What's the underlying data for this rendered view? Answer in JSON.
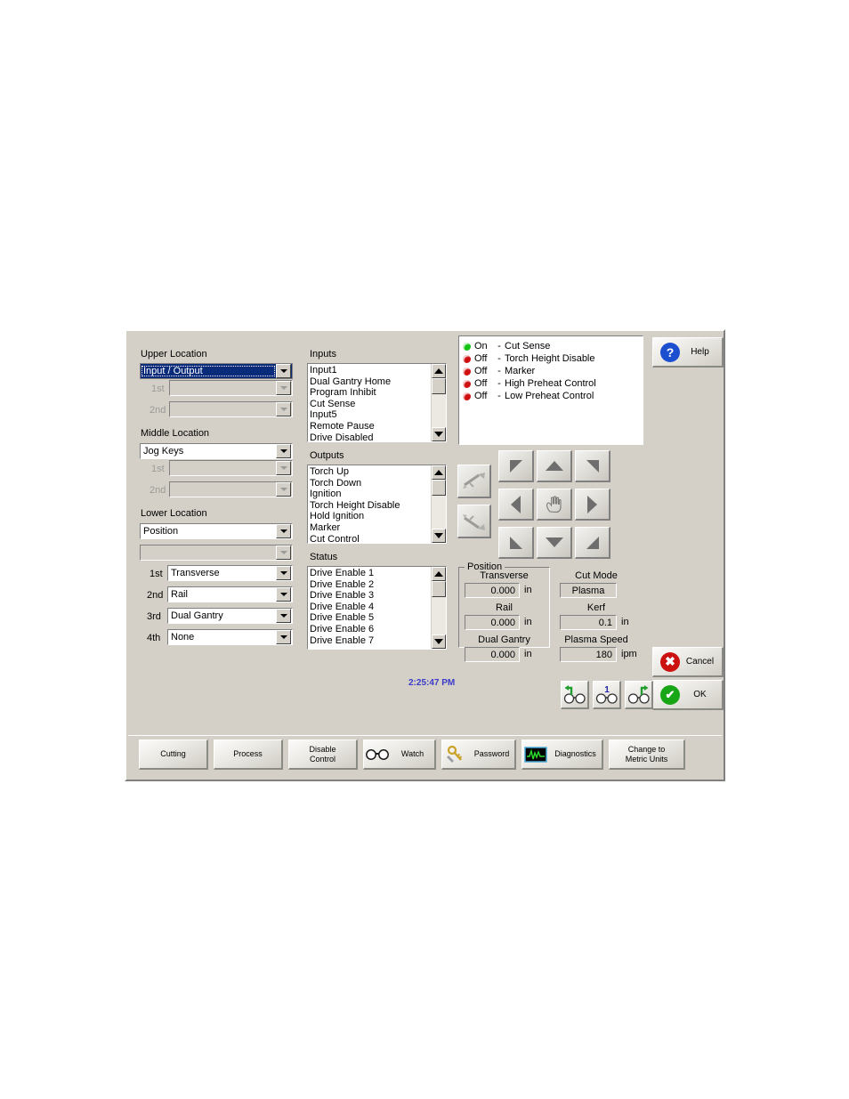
{
  "panel": {
    "clock": "2:25:47 PM"
  },
  "location": {
    "upper": {
      "label": "Upper Location",
      "value": "Input / Output",
      "sub1_label": "1st",
      "sub1_value": "",
      "sub2_label": "2nd",
      "sub2_value": ""
    },
    "middle": {
      "label": "Middle Location",
      "value": "Jog Keys",
      "sub1_label": "1st",
      "sub1_value": "",
      "sub2_label": "2nd",
      "sub2_value": ""
    },
    "lower": {
      "label": "Lower Location",
      "value": "Position",
      "sub_value": ""
    },
    "axes": [
      {
        "label": "1st",
        "value": "Transverse"
      },
      {
        "label": "2nd",
        "value": "Rail"
      },
      {
        "label": "3rd",
        "value": "Dual Gantry"
      },
      {
        "label": "4th",
        "value": "None"
      }
    ]
  },
  "lists": {
    "inputs": {
      "label": "Inputs",
      "items": [
        "Input1",
        "Dual Gantry Home",
        "Program Inhibit",
        "Cut Sense",
        "Input5",
        "Remote Pause",
        "Drive Disabled"
      ]
    },
    "outputs": {
      "label": "Outputs",
      "items": [
        "Torch Up",
        "Torch Down",
        "Ignition",
        "Torch Height Disable",
        "Hold Ignition",
        "Marker",
        "Cut Control"
      ]
    },
    "status": {
      "label": "Status",
      "items": [
        "Drive Enable 1",
        "Drive Enable 2",
        "Drive Enable 3",
        "Drive Enable 4",
        "Drive Enable 5",
        "Drive Enable 6",
        "Drive Enable 7"
      ]
    }
  },
  "indicators": {
    "on_color": "#14c414",
    "off_color": "#d01010",
    "rows": [
      {
        "state": "On",
        "dash": "-",
        "name": "Cut Sense"
      },
      {
        "state": "Off",
        "dash": "-",
        "name": "Torch Height Disable"
      },
      {
        "state": "Off",
        "dash": "-",
        "name": "Marker"
      },
      {
        "state": "Off",
        "dash": "-",
        "name": "High Preheat Control"
      },
      {
        "state": "Off",
        "dash": "-",
        "name": "Low Preheat Control"
      }
    ]
  },
  "jogpad": {
    "up_left": "jog-up-left",
    "up": "jog-up",
    "up_right": "jog-up-right",
    "left": "jog-left",
    "center": "jog-center-hand",
    "right": "jog-right",
    "down_left": "jog-down-left",
    "down": "jog-down",
    "down_right": "jog-down-right",
    "tool_top": "torch-tool-1",
    "tool_bottom": "torch-tool-2"
  },
  "position": {
    "group_label": "Position",
    "rows": [
      {
        "label": "Transverse",
        "value": "0.000",
        "unit": "in"
      },
      {
        "label": "Rail",
        "value": "0.000",
        "unit": "in"
      },
      {
        "label": "Dual Gantry",
        "value": "0.000",
        "unit": "in"
      }
    ]
  },
  "cut": {
    "mode_label": "Cut Mode",
    "mode_value": "Plasma",
    "kerf_label": "Kerf",
    "kerf_value": "0.1",
    "kerf_unit": "in",
    "speed_label": "Plasma Speed",
    "speed_value": "180",
    "speed_unit": "ipm"
  },
  "actions": {
    "help": {
      "label": "Help",
      "icon": "question-mark-icon",
      "color": "#1b4fd0"
    },
    "cancel": {
      "label": "Cancel",
      "icon": "x-mark-icon",
      "color": "#cc1111"
    },
    "ok": {
      "label": "OK",
      "icon": "check-mark-icon",
      "color": "#16a616"
    }
  },
  "watch_buttons": [
    {
      "name": "watch-prev",
      "badge": ""
    },
    {
      "name": "watch-window-number",
      "badge": "1"
    },
    {
      "name": "watch-next",
      "badge": ""
    }
  ],
  "toolbar": {
    "buttons": [
      {
        "label": "Cutting",
        "icon": ""
      },
      {
        "label": "Process",
        "icon": ""
      },
      {
        "label": "Disable\nControl",
        "line1": "Disable",
        "line2": "Control",
        "icon": ""
      },
      {
        "label": "Watch",
        "icon": "glasses-icon"
      },
      {
        "label": "Password",
        "icon": "keys-icon"
      },
      {
        "label": "Diagnostics",
        "icon": "waveform-icon"
      },
      {
        "label": "Change to\nMetric Units",
        "line1": "Change to",
        "line2": "Metric Units",
        "icon": ""
      }
    ]
  }
}
